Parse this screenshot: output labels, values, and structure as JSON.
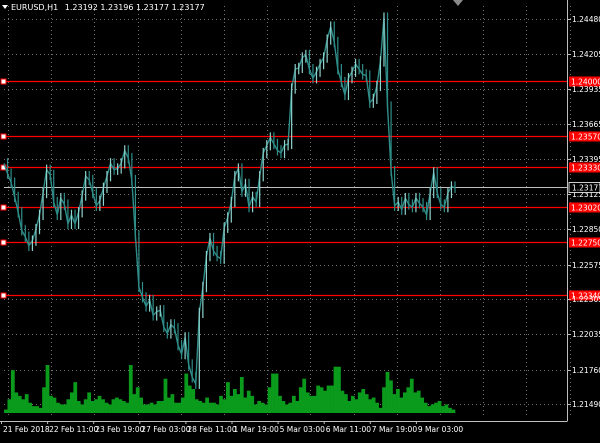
{
  "header": {
    "symbol_tf": "EURUSD,H1",
    "ohlc": "1.23192 1.23196 1.23177 1.23177"
  },
  "colors": {
    "background": "#000000",
    "grid": "#6f6f6f",
    "axis": "#bfbfbf",
    "price_line": "#2f8d89",
    "bull_candle": "#8fd3ce",
    "volume": "#0a9a1c",
    "level_line": "#ff0000",
    "current_line": "#c0c0c0"
  },
  "chart_data": {
    "type": "line",
    "instrument": "EURUSD",
    "timeframe": "H1",
    "ylim": [
      1.214,
      1.2458
    ],
    "y_ticks": [
      "1.24480",
      "1.24205",
      "1.23935",
      "1.23665",
      "1.23395",
      "1.23125",
      "1.22850",
      "1.22575",
      "1.22305",
      "1.22035",
      "1.21760",
      "1.21490"
    ],
    "x_tick_labels": [
      "21 Feb 2018",
      "22 Feb 11:00",
      "23 Feb 19:00",
      "27 Feb 03:00",
      "28 Feb 11:00",
      "1 Mar 19:00",
      "5 Mar 03:00",
      "6 Mar 11:00",
      "7 Mar 19:00",
      "9 Mar 03:00"
    ],
    "current_price": "1.23177",
    "levels": [
      {
        "price": 1.24,
        "label": "1.24000"
      },
      {
        "price": 1.2357,
        "label": "1.23570"
      },
      {
        "price": 1.2333,
        "label": "1.23330"
      },
      {
        "price": 1.2302,
        "label": "1.23020"
      },
      {
        "price": 1.2275,
        "label": "1.22750"
      },
      {
        "price": 1.2234,
        "label": "1.22340"
      }
    ],
    "price_series": [
      1.2336,
      1.2328,
      1.2321,
      1.231,
      1.2298,
      1.2284,
      1.2279,
      1.2272,
      1.2276,
      1.2285,
      1.2296,
      1.2313,
      1.2331,
      1.2327,
      1.2306,
      1.2296,
      1.2309,
      1.2304,
      1.2289,
      1.2296,
      1.2289,
      1.2298,
      1.2311,
      1.2326,
      1.2323,
      1.2313,
      1.2303,
      1.2307,
      1.2317,
      1.2326,
      1.2336,
      1.2331,
      1.2332,
      1.2336,
      1.2346,
      1.234,
      1.2323,
      1.228,
      1.224,
      1.2232,
      1.2225,
      1.223,
      1.2218,
      1.2221,
      1.2222,
      1.2209,
      1.2204,
      1.2211,
      1.2208,
      1.2195,
      1.2188,
      1.2201,
      1.218,
      1.217,
      1.2165,
      1.222,
      1.224,
      1.2264,
      1.2278,
      1.2268,
      1.2264,
      1.2262,
      1.2286,
      1.2294,
      1.2306,
      1.2326,
      1.2332,
      1.2314,
      1.232,
      1.2302,
      1.231,
      1.2306,
      1.2326,
      1.2344,
      1.235,
      1.2356,
      1.2351,
      1.2346,
      1.2344,
      1.235,
      1.2351,
      1.2394,
      1.2409,
      1.241,
      1.2418,
      1.242,
      1.2409,
      1.2402,
      1.2407,
      1.2413,
      1.2418,
      1.2432,
      1.2442,
      1.243,
      1.2409,
      1.2399,
      1.2389,
      1.2402,
      1.2407,
      1.2413,
      1.2409,
      1.2405,
      1.2404,
      1.2383,
      1.2386,
      1.2396,
      1.2415,
      1.2449,
      1.238,
      1.233,
      1.2303,
      1.2306,
      1.23,
      1.2309,
      1.2304,
      1.2302,
      1.2309,
      1.2305,
      1.2302,
      1.2296,
      1.2313,
      1.2329,
      1.2313,
      1.2304,
      1.2302,
      1.2313,
      1.2318,
      1.2317
    ],
    "volume_series": [
      2,
      8,
      25,
      12,
      10,
      8,
      11,
      6,
      4,
      4,
      3,
      15,
      28,
      10,
      9,
      6,
      5,
      5,
      8,
      12,
      18,
      7,
      5,
      8,
      12,
      7,
      8,
      10,
      8,
      6,
      5,
      8,
      9,
      8,
      7,
      6,
      28,
      11,
      15,
      9,
      5,
      5,
      6,
      5,
      7,
      7,
      20,
      9,
      11,
      6,
      6,
      9,
      23,
      16,
      14,
      8,
      7,
      6,
      9,
      6,
      6,
      5,
      10,
      8,
      18,
      10,
      14,
      11,
      21,
      9,
      13,
      10,
      5,
      7,
      6,
      5,
      15,
      23,
      23,
      10,
      7,
      5,
      6,
      10,
      7,
      15,
      20,
      12,
      10,
      10,
      16,
      15,
      13,
      16,
      16,
      27,
      27,
      13,
      11,
      7,
      10,
      8,
      12,
      14,
      11,
      8,
      9,
      6,
      3,
      15,
      24,
      19,
      11,
      14,
      9,
      12,
      15,
      20,
      12,
      13,
      9,
      6,
      4,
      5,
      6,
      7,
      4,
      5,
      3,
      2
    ]
  }
}
